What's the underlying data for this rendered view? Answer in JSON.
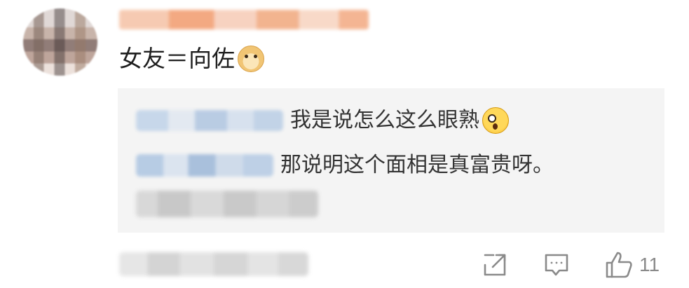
{
  "comment": {
    "text": "女友＝向佐",
    "emoji": "doge-icon"
  },
  "replies": [
    {
      "text": "我是说怎么这么眼熟",
      "emoji": "shocked-face-icon"
    },
    {
      "text": "那说明这个面相是真富贵呀。"
    }
  ],
  "actions": {
    "share_icon": "share-icon",
    "comment_icon": "comment-icon",
    "like_icon": "thumbs-up-icon",
    "like_count": "11"
  }
}
